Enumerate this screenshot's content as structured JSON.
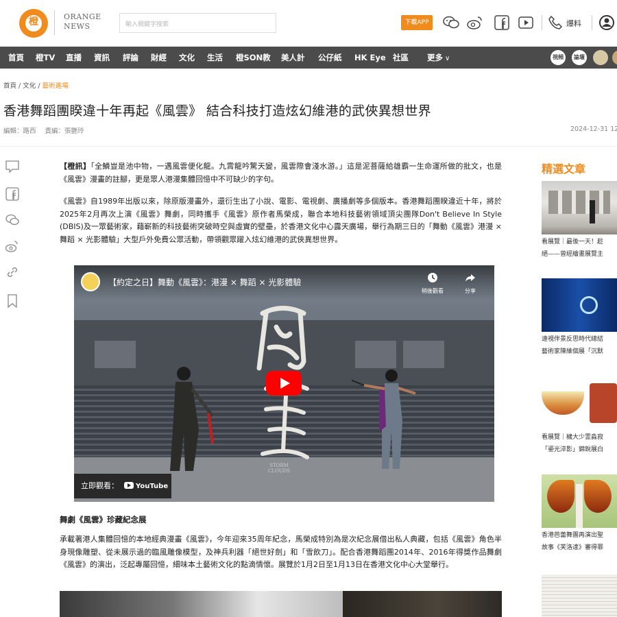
{
  "header": {
    "logo_char": "橙",
    "logo_en_line1": "ORANGE",
    "logo_en_line2": "NEWS",
    "search_placeholder": "輸入關鍵字搜索",
    "download_app": "下載APP",
    "hotline": "爆料"
  },
  "nav": {
    "items": [
      "首頁",
      "橙TV",
      "直播",
      "資訊",
      "評論",
      "財經",
      "文化",
      "生活",
      "橙SON教",
      "美人計",
      "公仔紙",
      "HK Eye",
      "社區",
      "更多"
    ],
    "circle_labels": [
      "視頻",
      "論壇"
    ]
  },
  "breadcrumb": {
    "home": "首頁",
    "sep": "/",
    "section": "文化",
    "current": "藝術進場"
  },
  "article": {
    "title": "香港舞蹈團睽違十年再起《風雲》 結合科技打造炫幻維港的武俠異想世界",
    "editor": "編輯：路西",
    "responsible_editor": "責編：張艷玲",
    "date": "2024-12-31 12",
    "p1_tag": "【橙訊】",
    "p1": "「全鱗豈是池中物，一遇風雲便化龍。九霄龍吟驚天變，風雲際會淺水游。」這是泥菩薩給雄霸一生命運所做的批文，也是《風雲》漫畫的註腳，更是眾人港漫集體回憶中不可缺少的字句。",
    "p2": "《風雲》自1989年出版以來，除原版漫畫外，還衍生出了小說、電影、電視劇、廣播劇等多個版本。香港舞蹈團睽違近十年，將於2025年2月再次上演《風雲》舞劇，同時攜手《風雲》原作者馬榮成，聯合本地科技藝術領域頂尖團隊Don't Believe In Style (DBIS)及一眾藝術家，藉嶄新的科技藝術突破時空與虛實的壁壘，於香港文化中心露天廣場，舉行為期三日的「舞動《風雲》港漫 × 舞蹈 × 光影體驗」大型戶外免費公眾活動，帶領觀眾躍入炫幻維港的武俠異想世界。",
    "subheading": "舞劇《風雲》珍藏紀念展",
    "p3": "承載著港人集體回憶的本地經典漫畫《風雲》，今年迎來35周年紀念，馬榮成特別為是次紀念展借出私人典藏，包括《風雲》角色半身現像雕塑、從未展示過的臨風雕像模型，及神兵利器「絕世好劍」和「雪飲刀」。配合香港舞蹈團2014年、2016年得獎作品舞劇《風雲》的演出，泛起專屬回憶，細味本土藝術文化的點滴情懷。展覽於1月2日至1月13日在香港文化中心大堂舉行。"
  },
  "video": {
    "title": "【約定之日】舞動《風雲》：港漫 × 舞蹈 × 光影體驗",
    "watch_later": "稍後觀看",
    "share": "分享",
    "watch_on": "立即觀看：",
    "youtube": "YouTube",
    "calligraphy_sub_1": "STORM",
    "calligraphy_sub_2": "CLOUDS"
  },
  "sidebar": {
    "title": "精選文章",
    "articles": [
      {
        "line1": "看展覽｜最後一天！趁",
        "line2": "絕——曾經繪畫展覽主"
      },
      {
        "line1": "遠視伴景反思時代總結",
        "line2": "藝術家陳維個展「沉默"
      },
      {
        "line1": "看展覽｜穢大少霊淼寂",
        "line2": "「鎏光淬影」錦銳展白"
      },
      {
        "line1": "香港芭蕾舞團再演出聖",
        "line2": "故事《芙洛達》審得罪"
      }
    ]
  },
  "colors": {
    "brand_orange": "#f08c1e",
    "nav_bg": "#4b4b4b",
    "play_red": "#ff0000"
  }
}
